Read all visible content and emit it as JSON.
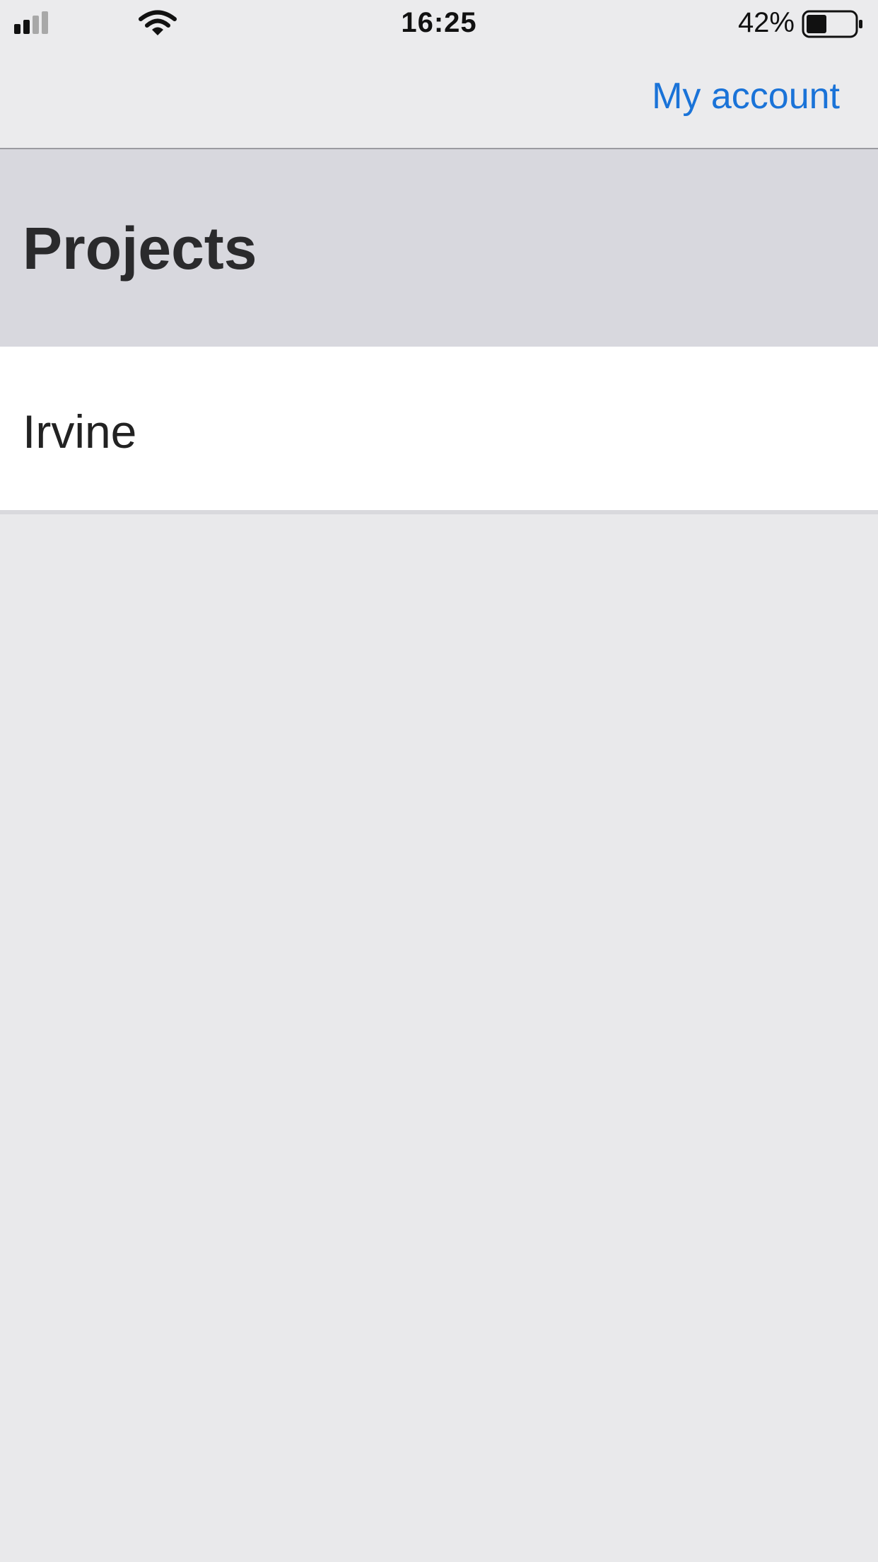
{
  "status_bar": {
    "time": "16:25",
    "battery_percent": "42%",
    "battery_level": 0.42,
    "signal_icon": "cellular-signal-icon",
    "wifi_icon": "wifi-icon",
    "battery_icon": "battery-icon"
  },
  "nav": {
    "account_label": "My account"
  },
  "section": {
    "title": "Projects"
  },
  "projects": [
    {
      "name": "Irvine"
    }
  ],
  "colors": {
    "link": "#1a73d8",
    "header_bg": "#d8d8de",
    "background": "#e9e9eb"
  }
}
